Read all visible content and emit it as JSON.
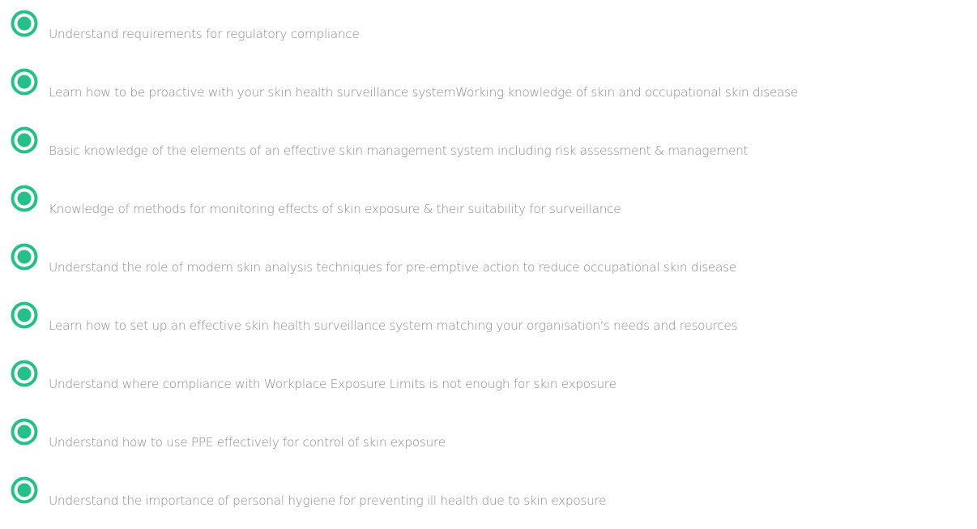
{
  "accent_color": "#24c08a",
  "text_color": "#8c8c8c",
  "objectives": [
    {
      "icon": "target-icon",
      "text": "Understand requirements for regulatory compliance"
    },
    {
      "icon": "target-icon",
      "text": "Learn how to be proactive with your skin health surveillance systemWorking knowledge of skin and occupational skin disease"
    },
    {
      "icon": "target-icon",
      "text": "Basic knowledge of the elements of an effective skin management system including risk assessment & management"
    },
    {
      "icon": "target-icon",
      "text": "Knowledge of methods for monitoring effects of skin exposure & their suitability for surveillance"
    },
    {
      "icon": "target-icon",
      "text": "Understand the role of modern skin analysis techniques for pre-emptive action to reduce occupational skin disease"
    },
    {
      "icon": "target-icon",
      "text": "Learn how to set up an effective skin health surveillance system matching your organisation's needs and resources"
    },
    {
      "icon": "target-icon",
      "text": "Understand where compliance with Workplace Exposure Limits is not enough for skin exposure"
    },
    {
      "icon": "target-icon",
      "text": "Understand how to use PPE effectively for control of skin exposure"
    },
    {
      "icon": "target-icon",
      "text": "Understand the importance of personal hygiene for preventing ill health due to skin exposure"
    }
  ]
}
